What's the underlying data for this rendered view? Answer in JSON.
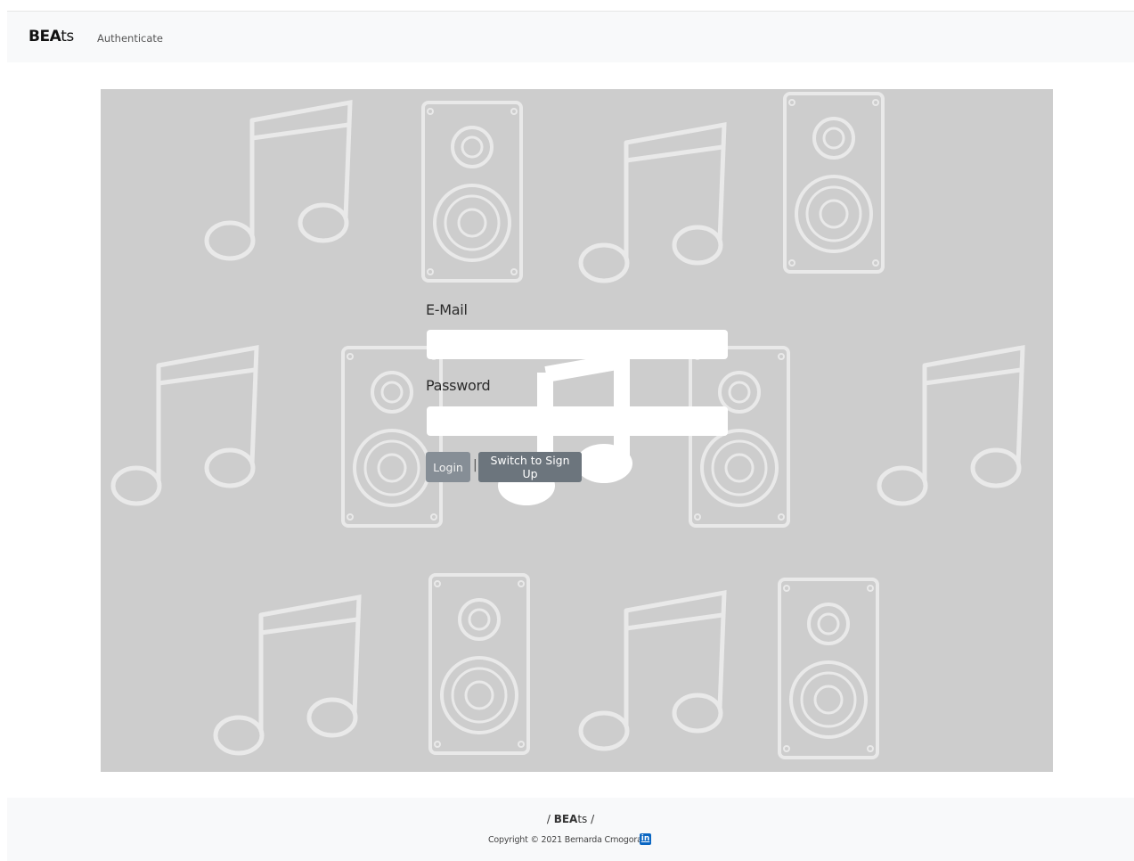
{
  "navbar": {
    "brand_bold": "BEA",
    "brand_rest": "ts",
    "links": [
      {
        "label": "Authenticate"
      }
    ]
  },
  "auth_form": {
    "email_label": "E-Mail",
    "email_value": "",
    "password_label": "Password",
    "password_value": "",
    "login_label": "Login",
    "separator": "|",
    "switch_label": "Switch to Sign Up"
  },
  "footer": {
    "slash_left": "/ ",
    "brand_bold": "BEA",
    "brand_rest": "ts",
    "slash_right": " /",
    "copyright": "Copyright © 2021 Bernarda Crnogorac",
    "social_icon": "linkedin-icon",
    "social_glyph": "in"
  },
  "colors": {
    "hero_background": "#cdcdcd",
    "button_primary": "#868e96",
    "button_secondary": "#6c757d",
    "linkedin": "#0a66c2",
    "navbar": "#f8f9fa"
  }
}
